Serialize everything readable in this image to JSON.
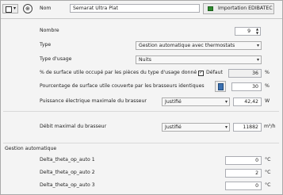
{
  "header": {
    "name_label": "Nom",
    "name_value": "Semarat Ultra Plat",
    "import_button": "Importation EDIBATEC"
  },
  "fields": {
    "nombre": {
      "label": "Nombre",
      "value": "9"
    },
    "type": {
      "label": "Type",
      "value": "Gestion automatique avec thermostats"
    },
    "type_usage": {
      "label": "Type d'usage",
      "value": "Nuits"
    },
    "pct_surface_occupee": {
      "label": "% de surface utile occupé par les pièces du type d'usage donné",
      "checkbox_label": "Défaut",
      "checked": true,
      "value": "36",
      "unit": "%"
    },
    "pct_surface_couverte": {
      "label": "Pourcentage de surface utile couverte par les brasseurs identiques",
      "value": "30",
      "unit": "%"
    },
    "puissance": {
      "label": "Puissance électrique maximale du brasseur",
      "mode": "Justifié",
      "value": "42,42",
      "unit": "W"
    },
    "debit": {
      "label": "Débit maximal du brasseur",
      "mode": "Justifié",
      "value": "11882",
      "unit": "m³/h"
    }
  },
  "gestion": {
    "section_title": "Gestion automatique",
    "rows": [
      {
        "label": "Delta_theta_op_auto 1",
        "value": "0",
        "unit": "°C"
      },
      {
        "label": "Delta_theta_op_auto 2",
        "value": "2",
        "unit": "°C"
      },
      {
        "label": "Delta_theta_op_auto 3",
        "value": "0",
        "unit": "°C"
      }
    ]
  },
  "colors": {
    "accent_green": "#2e8b2e",
    "window_bg": "#f0f0f0"
  }
}
